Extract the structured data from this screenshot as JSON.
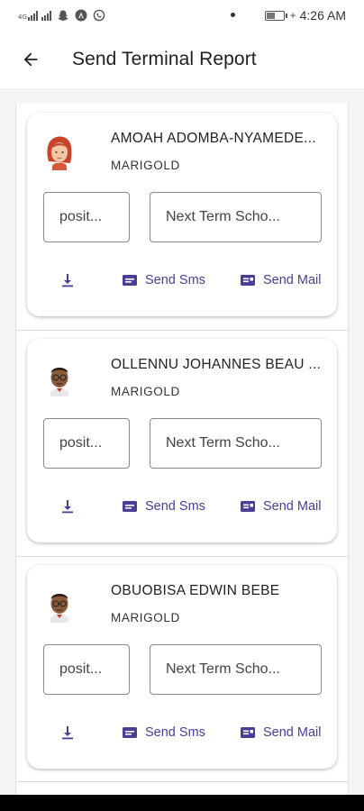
{
  "status_bar": {
    "network_label": "4G",
    "time": "4:26 AM",
    "battery_level": 0.55,
    "icons": [
      "signal-icon",
      "snapchat-icon",
      "app-a-icon",
      "whatsapp-icon",
      "battery-icon"
    ]
  },
  "header": {
    "title": "Send Terminal Report",
    "back_icon": "arrow-left-icon"
  },
  "students": [
    {
      "name": "AMOAH ADOMBA-NYAMEDE...",
      "class": "MARIGOLD",
      "avatar": "female-avatar-red-hair",
      "position_placeholder": "posit...",
      "next_term_placeholder": "Next Term Scho..."
    },
    {
      "name": "OLLENNU JOHANNES BEAU ...",
      "class": "MARIGOLD",
      "avatar": "male-avatar-glasses",
      "position_placeholder": "posit...",
      "next_term_placeholder": "Next Term Scho..."
    },
    {
      "name": "OBUOBISA EDWIN BEBE",
      "class": "MARIGOLD",
      "avatar": "male-avatar-glasses",
      "position_placeholder": "posit...",
      "next_term_placeholder": "Next Term Scho..."
    }
  ],
  "actions": {
    "download_icon": "download-icon",
    "send_sms_label": "Send Sms",
    "send_mail_label": "Send Mail"
  },
  "colors": {
    "accent": "#4b3e96",
    "card_background": "#ffffff",
    "list_background": "#f4f4f4"
  }
}
